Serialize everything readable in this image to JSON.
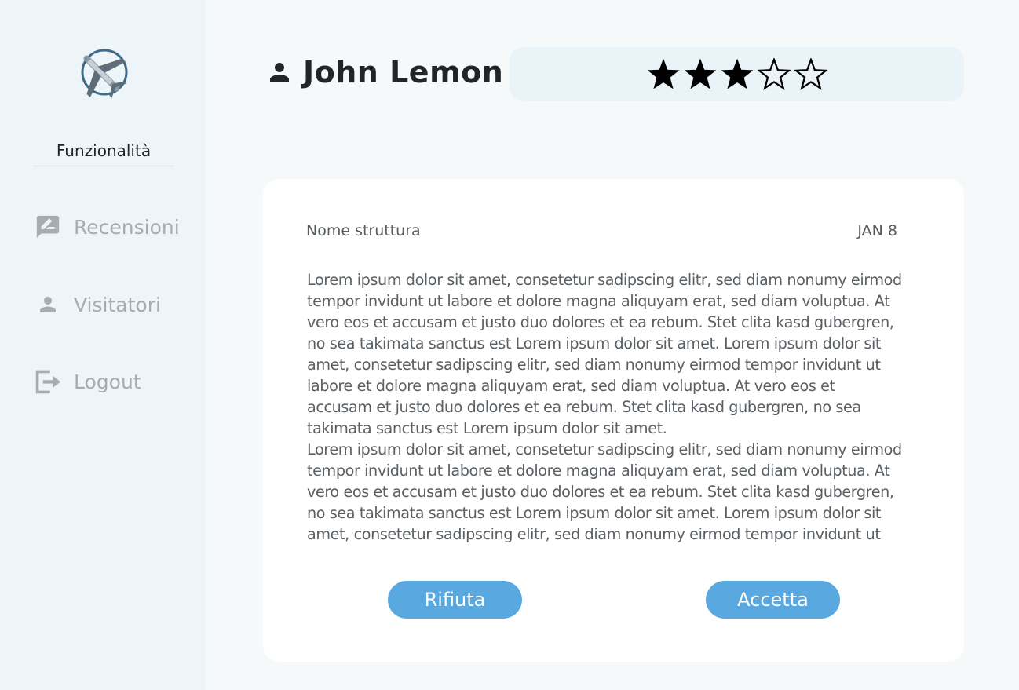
{
  "sidebar": {
    "logo_icon": "airplane-logo-icon",
    "section_title": "Funzionalità",
    "items": [
      {
        "label": "Recensioni",
        "icon": "review-edit-icon"
      },
      {
        "label": "Visitatori",
        "icon": "person-icon"
      },
      {
        "label": "Logout",
        "icon": "logout-icon"
      }
    ]
  },
  "header": {
    "user_icon": "person-icon",
    "user_name": "John Lemon",
    "rating": {
      "value": 3,
      "max": 5
    }
  },
  "review": {
    "structure_label": "Nome struttura",
    "date": "JAN 8",
    "paragraphs": [
      "Lorem ipsum dolor sit amet, consetetur sadipscing elitr, sed diam nonumy eirmod tempor invidunt ut labore et dolore magna aliquyam erat, sed diam voluptua. At vero eos et accusam et justo duo dolores et ea rebum. Stet clita kasd gubergren, no sea takimata sanctus est Lorem ipsum dolor sit amet. Lorem ipsum dolor sit amet, consetetur sadipscing elitr, sed diam nonumy eirmod tempor invidunt ut labore et dolore magna aliquyam erat, sed diam voluptua. At vero eos et accusam et justo duo dolores et ea rebum. Stet clita kasd gubergren, no sea takimata sanctus est Lorem ipsum dolor sit amet.",
      "Lorem ipsum dolor sit amet, consetetur sadipscing elitr, sed diam nonumy eirmod tempor invidunt ut labore et dolore magna aliquyam erat, sed diam voluptua. At vero eos et accusam et justo duo dolores et ea rebum. Stet clita kasd gubergren, no sea takimata sanctus est Lorem ipsum dolor sit amet. Lorem ipsum dolor sit amet, consetetur sadipscing elitr, sed diam nonumy eirmod tempor invidunt ut labore et"
    ],
    "reject_label": "Rifiuta",
    "accept_label": "Accetta"
  },
  "colors": {
    "sidebar_bg": "#eef5f9",
    "accent_button": "#5aa8e0",
    "rating_bg": "#eaf3f8",
    "nav_text": "#a6acb0"
  }
}
